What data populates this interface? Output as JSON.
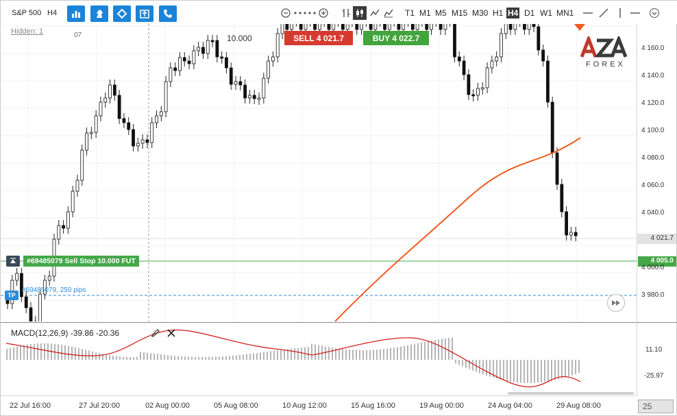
{
  "toolbar": {
    "symbol": "S&P 500",
    "timeframe": "H4",
    "buttons": [
      "bar-chart-icon",
      "chess-knight-icon",
      "diamond-icon",
      "upload-icon",
      "phone-icon"
    ],
    "timeframes": [
      "T1",
      "M1",
      "M5",
      "M15",
      "M30",
      "H1",
      "H4",
      "D1",
      "W1",
      "MN1"
    ],
    "active_timeframe": "H4"
  },
  "chart": {
    "hidden_label": "Hidden: 1",
    "minor_label": "07",
    "volume": "10.000",
    "sell_label": "SELL 4 021.7",
    "buy_label": "BUY 4 022.7",
    "logo": "AZAFOREX",
    "logo_sub": "FOREX",
    "order_label": "#69485079 Sell Stop 10.000 FUT",
    "order_price": "4 005.0",
    "current_price": "4 021.7",
    "tp_badge": "TP",
    "tp_label": "#69485079, 250 pips",
    "price_ticks": [
      "4 160.0",
      "4 140.0",
      "4 120.0",
      "4 100.0",
      "4 080.0",
      "4 060.0",
      "4 040.0",
      "4 000.0",
      "3 980.0"
    ],
    "time_ticks": [
      "22 Jul 16:00",
      "27 Jul 20:00",
      "02 Aug 00:00",
      "05 Aug 08:00",
      "10 Aug 12:00",
      "15 Aug 16:00",
      "19 Aug 00:00",
      "24 Aug 04:00",
      "29 Aug 08:00"
    ],
    "zoom": "25",
    "colors": {
      "sell": "#d63a2f",
      "buy": "#43a33c",
      "accent": "#1b84d8",
      "ma": "#f05a1e",
      "macd_signal": "#d22020"
    }
  },
  "macd": {
    "label": "MACD(12,26,9) -39.86 -20.36",
    "ticks": [
      "11.10",
      "-25.97"
    ]
  }
}
